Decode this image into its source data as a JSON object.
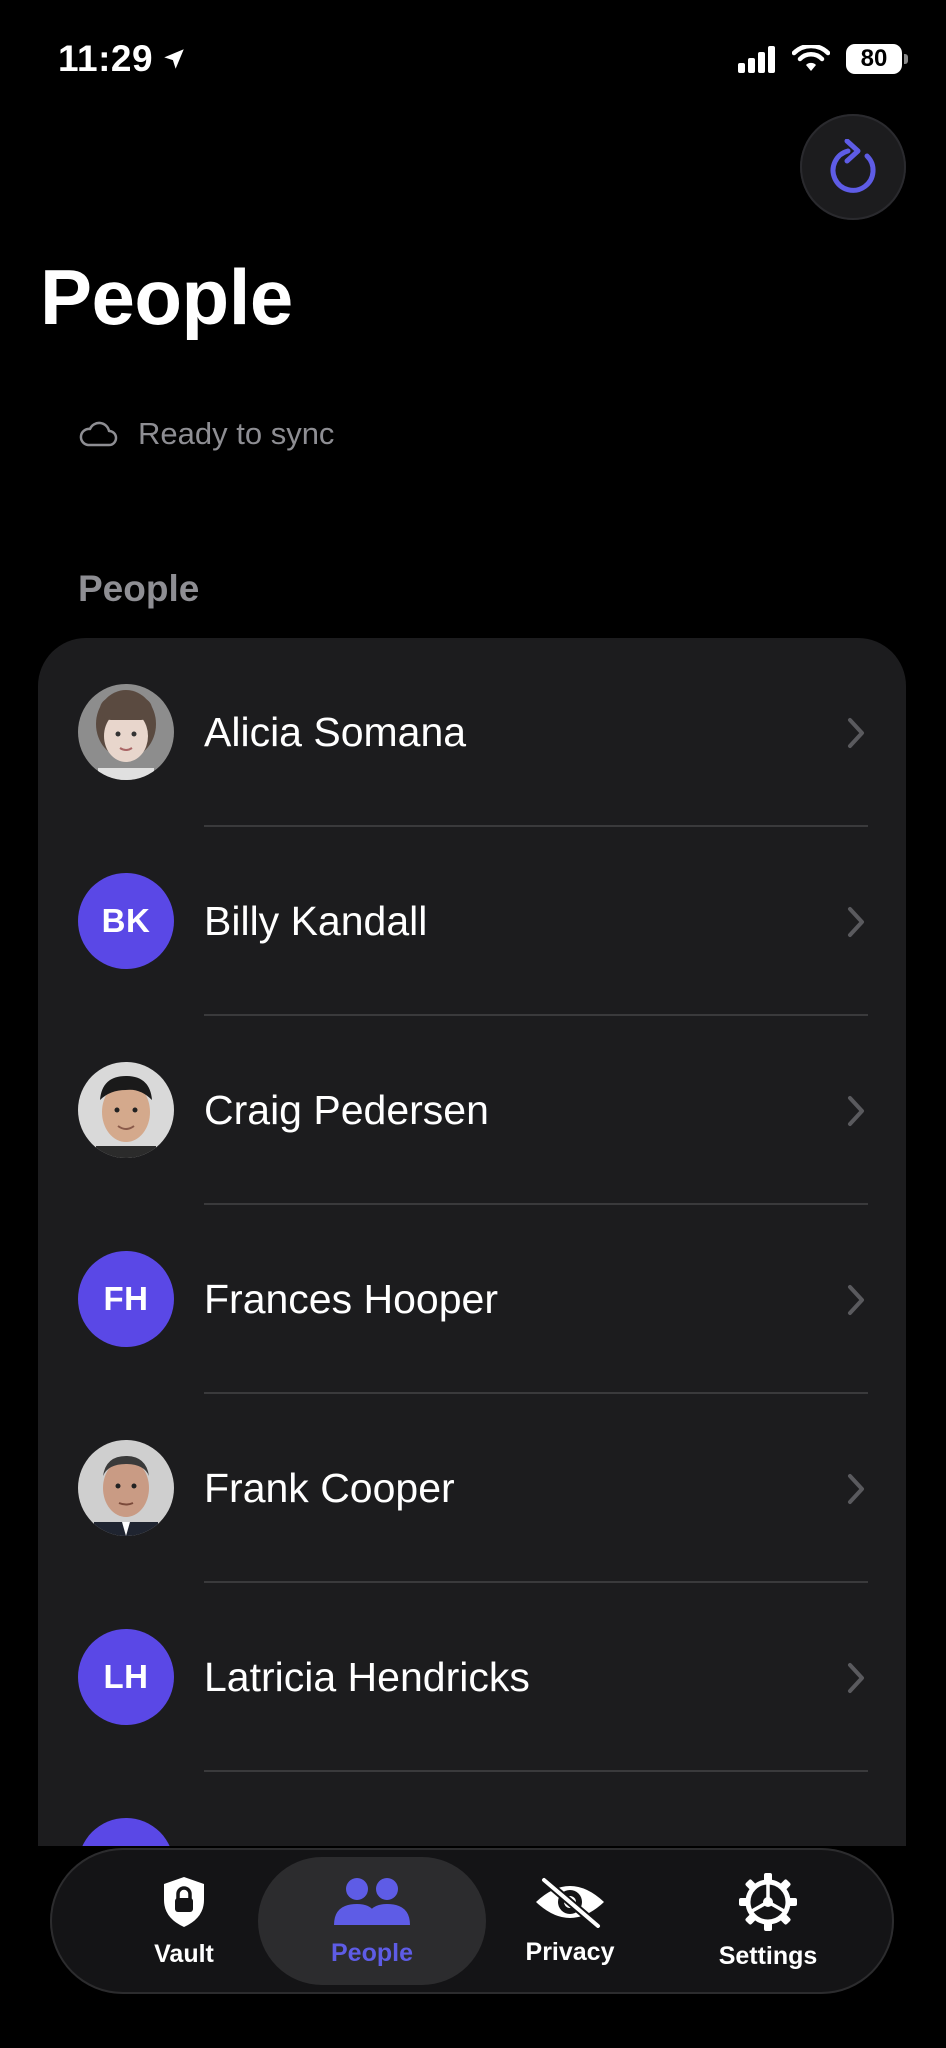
{
  "status_bar": {
    "time": "11:29",
    "battery": "80"
  },
  "header": {
    "title": "People",
    "sync_status": "Ready to sync"
  },
  "section": {
    "title": "People"
  },
  "people": [
    {
      "name": "Alicia Somana",
      "initials": "",
      "avatar": "photo"
    },
    {
      "name": "Billy Kandall",
      "initials": "BK",
      "avatar": "initials"
    },
    {
      "name": "Craig Pedersen",
      "initials": "",
      "avatar": "photo"
    },
    {
      "name": "Frances Hooper",
      "initials": "FH",
      "avatar": "initials"
    },
    {
      "name": "Frank Cooper",
      "initials": "",
      "avatar": "photo"
    },
    {
      "name": "Latricia Hendricks",
      "initials": "LH",
      "avatar": "initials"
    }
  ],
  "tabs": [
    {
      "label": "Vault",
      "icon": "shield-lock-icon",
      "active": false
    },
    {
      "label": "People",
      "icon": "people-icon",
      "active": true
    },
    {
      "label": "Privacy",
      "icon": "eye-slash-icon",
      "active": false
    },
    {
      "label": "Settings",
      "icon": "gear-icon",
      "active": false
    }
  ],
  "colors": {
    "accent": "#5e5ce6",
    "avatar_bg": "#5a48e6",
    "card_bg": "#1c1c1e",
    "background": "#000000",
    "secondary_text": "#8e8e93"
  }
}
